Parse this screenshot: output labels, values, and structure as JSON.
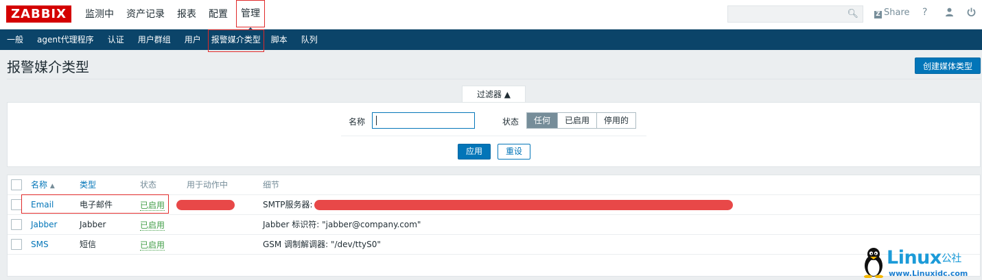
{
  "header": {
    "logo": "ZABBIX",
    "menu": [
      "监测中",
      "资产记录",
      "报表",
      "配置",
      "管理"
    ],
    "active_menu": "管理",
    "search_placeholder": "",
    "share_label": "Share",
    "help_glyph": "?"
  },
  "subnav": {
    "items": [
      "一般",
      "agent代理程序",
      "认证",
      "用户群组",
      "用户",
      "报警媒介类型",
      "脚本",
      "队列"
    ],
    "active": "报警媒介类型"
  },
  "page": {
    "title": "报警媒介类型",
    "create_button": "创建媒体类型"
  },
  "filter": {
    "tab_label": "过滤器",
    "tab_arrow": "▲",
    "name_label": "名称",
    "name_value": "",
    "status_label": "状态",
    "status_options": [
      "任何",
      "已启用",
      "停用的"
    ],
    "status_selected": "任何",
    "apply_label": "应用",
    "reset_label": "重设"
  },
  "table": {
    "columns": {
      "name": "名称",
      "name_sort_arrow": "▲",
      "type": "类型",
      "status": "状态",
      "used_in_actions": "用于动作中",
      "details": "细节"
    },
    "rows": [
      {
        "name": "Email",
        "type": "电子邮件",
        "status": "已启用",
        "details": "SMTP服务器: "
      },
      {
        "name": "Jabber",
        "type": "Jabber",
        "status": "已启用",
        "details": "Jabber 标识符: \"jabber@company.com\""
      },
      {
        "name": "SMS",
        "type": "短信",
        "status": "已启用",
        "details": "GSM 调制解调器: \"/dev/ttyS0\""
      }
    ]
  },
  "watermark": {
    "brand": "Linux",
    "brand_cn": "公社",
    "url": "www.Linuxidc.com"
  },
  "colors": {
    "nav_bg": "#0b4469",
    "accent": "#0275b8",
    "logo_red": "#d40000",
    "enabled_green": "#429e47",
    "highlight_red": "#e02828"
  }
}
